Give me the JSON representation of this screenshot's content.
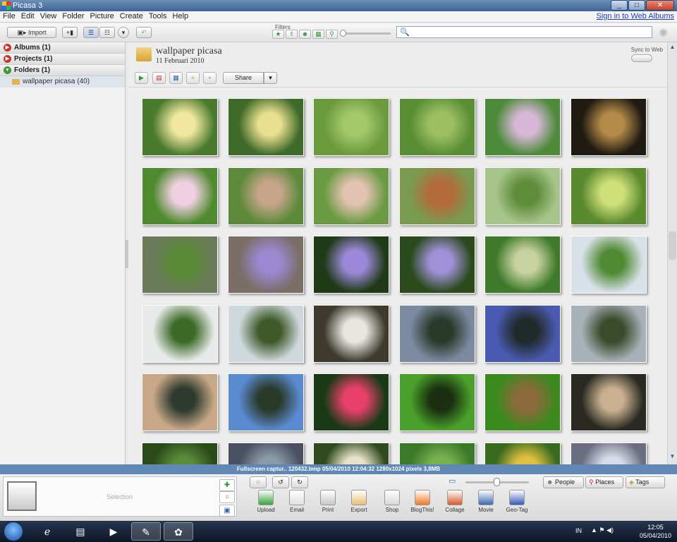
{
  "window": {
    "title": "Picasa 3",
    "minimize": "_",
    "maximize": "□",
    "close": "✕"
  },
  "menu": {
    "items": [
      "File",
      "Edit",
      "View",
      "Folder",
      "Picture",
      "Create",
      "Tools",
      "Help"
    ],
    "signin": "Sign in to Web Albums"
  },
  "toolbar": {
    "import_label": "Import",
    "filters_label": "Filters",
    "search_placeholder": ""
  },
  "sidebar": {
    "sections": [
      {
        "label": "Albums (1)",
        "state": "collapsed"
      },
      {
        "label": "Projects (1)",
        "state": "collapsed"
      },
      {
        "label": "Folders (1)",
        "state": "expanded"
      }
    ],
    "folder": "wallpaper picasa (40)"
  },
  "folder": {
    "title": "wallpaper picasa",
    "date": "11 Februari 2010",
    "sync_label": "Sync to Web"
  },
  "actions": {
    "share_label": "Share"
  },
  "thumbnails": [
    {
      "c1": "#4a7a2e",
      "c2": "#f1e7a0"
    },
    {
      "c1": "#3f6b2a",
      "c2": "#e9df8e"
    },
    {
      "c1": "#6a9a3c",
      "c2": "#a3c86a"
    },
    {
      "c1": "#5a8e34",
      "c2": "#9cc060"
    },
    {
      "c1": "#4d8a3a",
      "c2": "#d8b7d8"
    },
    {
      "c1": "#1f1a12",
      "c2": "#b48a48"
    },
    {
      "c1": "#4f8a2e",
      "c2": "#f0cfe2"
    },
    {
      "c1": "#5d8a3a",
      "c2": "#c7a58a"
    },
    {
      "c1": "#6a9a42",
      "c2": "#e2c2b0"
    },
    {
      "c1": "#7a9a50",
      "c2": "#b46a3a"
    },
    {
      "c1": "#a7c48a",
      "c2": "#5e8c3a"
    },
    {
      "c1": "#5a8a2e",
      "c2": "#cfe07a"
    },
    {
      "c1": "#6b7a5a",
      "c2": "#5a8a36"
    },
    {
      "c1": "#7a6e66",
      "c2": "#9a88d0"
    },
    {
      "c1": "#1e3a16",
      "c2": "#9c88d8"
    },
    {
      "c1": "#2a4a1c",
      "c2": "#a090d8"
    },
    {
      "c1": "#3e7a2a",
      "c2": "#c8d2a0"
    },
    {
      "c1": "#d8e0e8",
      "c2": "#4e8a32"
    },
    {
      "c1": "#e6eae8",
      "c2": "#3e6a28"
    },
    {
      "c1": "#cfd8dc",
      "c2": "#3e5a2a"
    },
    {
      "c1": "#3e3a2e",
      "c2": "#e8e6e0"
    },
    {
      "c1": "#7a8aa0",
      "c2": "#2a3a2a"
    },
    {
      "c1": "#4a5ab0",
      "c2": "#202a2a"
    },
    {
      "c1": "#a8b0b8",
      "c2": "#3a4a2a"
    },
    {
      "c1": "#c8a888",
      "c2": "#2e3a2e"
    },
    {
      "c1": "#5a8ad0",
      "c2": "#2a3a2a"
    },
    {
      "c1": "#1a3a16",
      "c2": "#e8406a"
    },
    {
      "c1": "#4aa02a",
      "c2": "#1a3010"
    },
    {
      "c1": "#3a8a1e",
      "c2": "#8a6a3a"
    },
    {
      "c1": "#2a2a22",
      "c2": "#c8b090"
    },
    {
      "c1": "#2a4a1a",
      "c2": "#5a8a3a"
    },
    {
      "c1": "#4a5060",
      "c2": "#8a9aa8"
    },
    {
      "c1": "#2e4a1e",
      "c2": "#e8e0c8"
    },
    {
      "c1": "#3a7a2a",
      "c2": "#7ab050"
    },
    {
      "c1": "#3a6a1e",
      "c2": "#e0c040"
    },
    {
      "c1": "#6a6e80",
      "c2": "#d8dce8"
    }
  ],
  "statusbar": {
    "text": "Fullscreen captur.. 120432.bmp    05/04/2010 12:04:32    1280x1024 pixels    3,8MB"
  },
  "tray": {
    "selection_label": "Selection",
    "tools": [
      {
        "label": "Upload",
        "color": "#3aa43a"
      },
      {
        "label": "Email",
        "color": "#e0e0e0"
      },
      {
        "label": "Print",
        "color": "#c8c8c8"
      },
      {
        "label": "Export",
        "color": "#e8c070"
      },
      {
        "label": "Shop",
        "color": "#d8d8d8"
      },
      {
        "label": "BlogThis!",
        "color": "#f07820"
      },
      {
        "label": "Collage",
        "color": "#d85a2a"
      },
      {
        "label": "Movie",
        "color": "#3a6ab0"
      },
      {
        "label": "Geo-Tag",
        "color": "#3a5ab8"
      }
    ],
    "people_label": "People",
    "places_label": "Places",
    "tags_label": "Tags"
  },
  "taskbar": {
    "lang": "IN",
    "time": "12:05",
    "date": "05/04/2010"
  }
}
